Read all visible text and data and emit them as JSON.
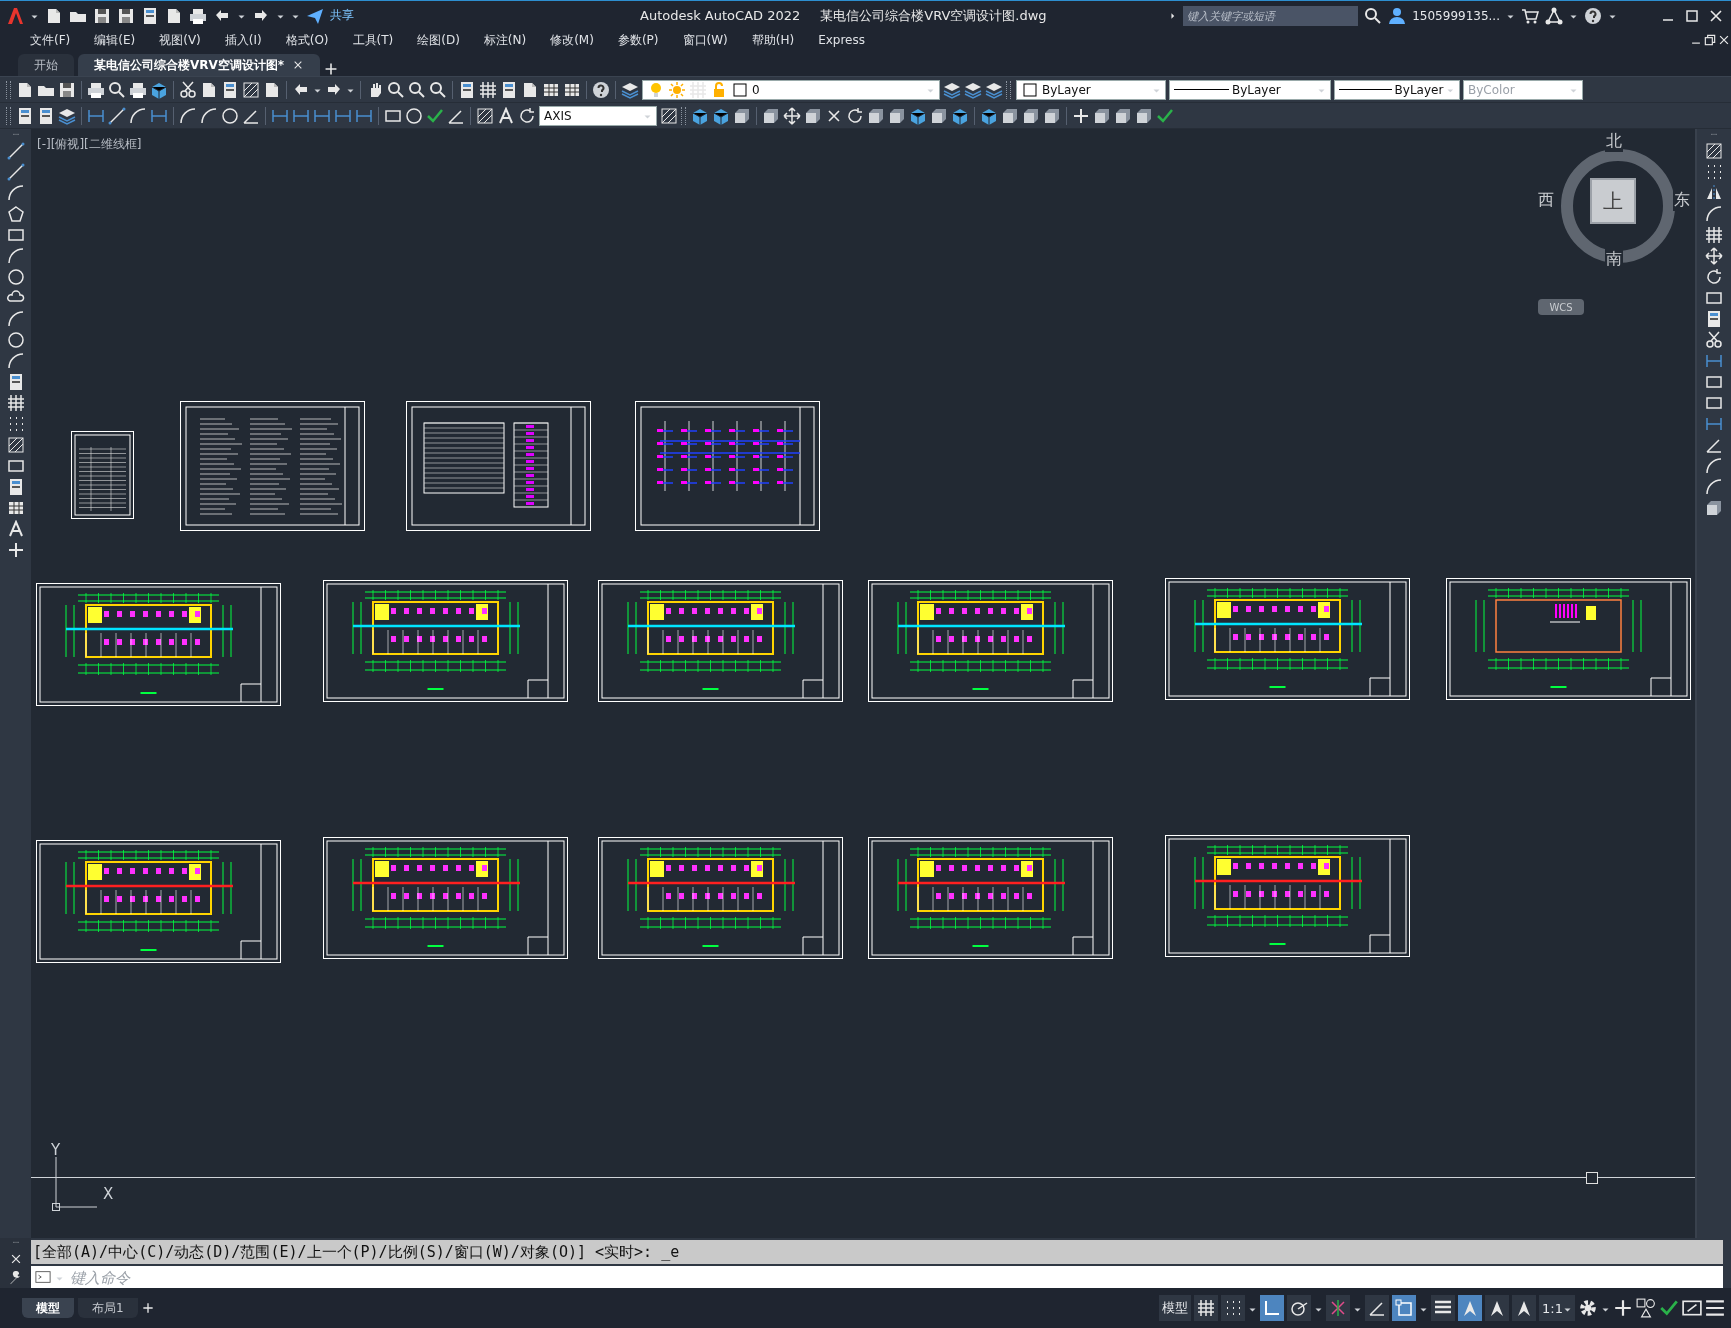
{
  "title_bar": {
    "share": "共享",
    "app_title": "Autodesk AutoCAD 2022",
    "document_title": "某电信公司综合楼VRV空调设计图.dwg",
    "search": {
      "placeholder": "键入关键字或短语"
    },
    "user": "1505999135..."
  },
  "menu": [
    "文件(F)",
    "编辑(E)",
    "视图(V)",
    "插入(I)",
    "格式(O)",
    "工具(T)",
    "绘图(D)",
    "标注(N)",
    "修改(M)",
    "参数(P)",
    "窗口(W)",
    "帮助(H)",
    "Express"
  ],
  "tabs": [
    {
      "label": "开始",
      "selected": false
    },
    {
      "label": "某电信公司综合楼VRV空调设计图*",
      "selected": true
    }
  ],
  "toolbar": {
    "layer": "0",
    "dim_style": "AXIS",
    "color_control": "ByLayer",
    "linetype": "ByLayer",
    "lineweight": "ByLayer",
    "plot_style": {
      "value": "ByColor",
      "disabled": true
    }
  },
  "viewport": {
    "label": "[-][俯视][二维线框]",
    "viewcube": {
      "north": "北",
      "south": "南",
      "west": "西",
      "east": "东",
      "face": "上",
      "ucs": "WCS"
    },
    "ucs_icon": {
      "y": "Y",
      "x": "X"
    },
    "sheets": [
      {
        "kind": "cover"
      },
      {
        "kind": "notes"
      },
      {
        "kind": "table"
      },
      {
        "kind": "schematic"
      },
      {
        "kind": "plan"
      },
      {
        "kind": "plan"
      },
      {
        "kind": "plan"
      },
      {
        "kind": "plan"
      },
      {
        "kind": "plan"
      },
      {
        "kind": "roof"
      },
      {
        "kind": "duct_plan"
      },
      {
        "kind": "duct_plan"
      },
      {
        "kind": "duct_plan"
      },
      {
        "kind": "duct_plan"
      },
      {
        "kind": "duct_plan"
      }
    ]
  },
  "command": {
    "history": "[全部(A)/中心(C)/动态(D)/范围(E)/上一个(P)/比例(S)/窗口(W)/对象(O)] <实时>: _e",
    "placeholder": "键入命令"
  },
  "layout_tabs": [
    {
      "label": "模型",
      "selected": true
    },
    {
      "label": "布局1",
      "selected": false
    }
  ],
  "status_bar": {
    "model": "模型",
    "scale": "1:1",
    "toggles": [
      {
        "on": false
      },
      {
        "on": false
      },
      {
        "on": true
      },
      {
        "on": false
      },
      {
        "on": false
      },
      {
        "on": false
      },
      {
        "on": true
      },
      {
        "on": false
      },
      {
        "on": true
      },
      {
        "on": false
      },
      {
        "on": false
      }
    ]
  }
}
